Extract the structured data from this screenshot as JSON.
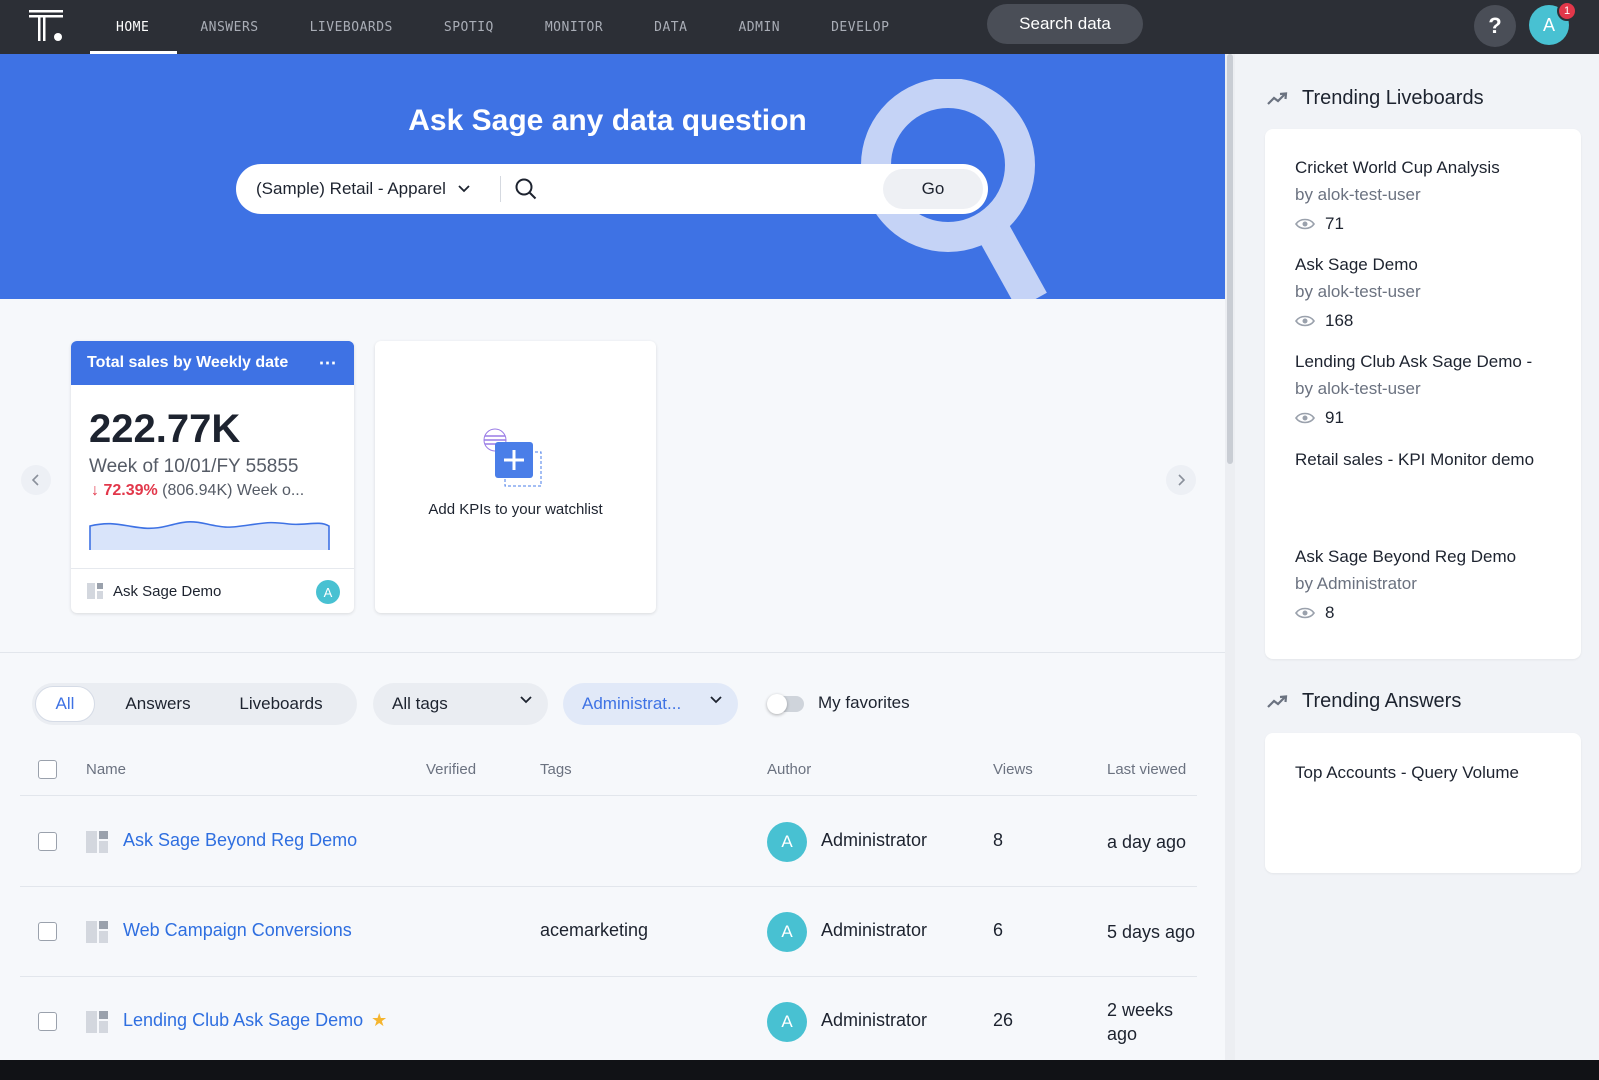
{
  "nav": {
    "items": [
      {
        "label": "HOME",
        "active": true
      },
      {
        "label": "ANSWERS"
      },
      {
        "label": "LIVEBOARDS"
      },
      {
        "label": "SPOTIQ"
      },
      {
        "label": "MONITOR"
      },
      {
        "label": "DATA"
      },
      {
        "label": "ADMIN"
      },
      {
        "label": "DEVELOP"
      }
    ],
    "search_label": "Search data",
    "help_label": "?",
    "avatar_initial": "A",
    "notification_count": "1"
  },
  "hero": {
    "title": "Ask Sage any data question",
    "source": "(Sample) Retail - Apparel",
    "query_value": "",
    "go_label": "Go"
  },
  "kpi": {
    "title": "Total sales by Weekly date",
    "value": "222.77K",
    "period": "Week of 10/01/FY 55855",
    "change_pct": "72.39%",
    "change_rest": "(806.94K) Week o...",
    "liveboard": "Ask Sage Demo",
    "owner_initial": "A"
  },
  "add_kpi": {
    "label": "Add KPIs to your watchlist"
  },
  "filters": {
    "segments": [
      {
        "label": "All",
        "active": true
      },
      {
        "label": "Answers"
      },
      {
        "label": "Liveboards"
      }
    ],
    "tags_label": "All tags",
    "author_label": "Administrat...",
    "favorites_label": "My favorites",
    "favorites_on": false
  },
  "table": {
    "headers": {
      "name": "Name",
      "verified": "Verified",
      "tags": "Tags",
      "author": "Author",
      "views": "Views",
      "last_viewed": "Last viewed"
    },
    "rows": [
      {
        "name": "Ask Sage Beyond Reg Demo",
        "tags": "",
        "author_initial": "A",
        "author": "Administrator",
        "views": "8",
        "last_viewed": "a day ago",
        "favorite": false
      },
      {
        "name": "Web Campaign Conversions",
        "tags": "acemarketing",
        "author_initial": "A",
        "author": "Administrator",
        "views": "6",
        "last_viewed": "5 days ago",
        "favorite": false
      },
      {
        "name": "Lending Club Ask Sage Demo",
        "tags": "",
        "author_initial": "A",
        "author": "Administrator",
        "views": "26",
        "last_viewed": "2 weeks ago",
        "favorite": true
      }
    ]
  },
  "sidebar": {
    "liveboards_title": "Trending Liveboards",
    "liveboards": [
      {
        "name": "Cricket World Cup Analysis",
        "by": "by alok-test-user",
        "views": "71"
      },
      {
        "name": "Ask Sage Demo",
        "by": "by alok-test-user",
        "views": "168"
      },
      {
        "name": "Lending Club Ask Sage Demo -",
        "by": "by alok-test-user",
        "views": "91"
      },
      {
        "name": "Retail sales - KPI Monitor demo",
        "by": "",
        "views": ""
      },
      {
        "name": "Ask Sage Beyond Reg Demo",
        "by": "by Administrator",
        "views": "8"
      }
    ],
    "answers_title": "Trending Answers",
    "answers": [
      {
        "name": "Top Accounts - Query Volume"
      }
    ]
  },
  "colors": {
    "primary": "#3e72e4",
    "nav_bg": "#2c2f36",
    "avatar": "#48c1d2",
    "negative": "#e2374a",
    "star": "#f5b52e"
  },
  "icons": [
    "logo-icon",
    "help-icon",
    "chevron-down-icon",
    "search-icon",
    "magnifier-illustration",
    "more-icon",
    "down-arrow-icon",
    "liveboard-icon",
    "add-kpi-icon",
    "chevron-left-icon",
    "chevron-right-icon",
    "trending-icon",
    "eye-icon",
    "star-icon"
  ]
}
